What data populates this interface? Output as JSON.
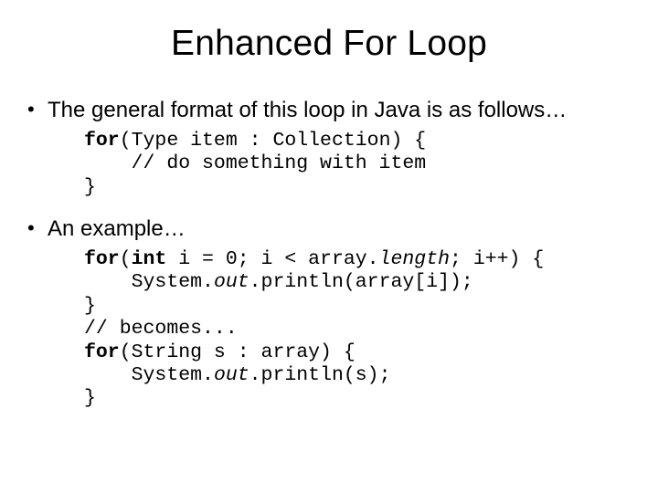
{
  "title": "Enhanced For Loop",
  "bullets": {
    "b1": "The general format of this loop in Java is as follows…",
    "b2": "An example…"
  },
  "code1": {
    "l1a": "for",
    "l1b": "(Type item : Collection) {",
    "l2": "    // do something with item",
    "l3": "}"
  },
  "code2": {
    "l1a": "for",
    "l1b": "(",
    "l1c": "int",
    "l1d": " i = 0; i < array.",
    "l1e": "length",
    "l1f": "; i++) {",
    "l2a": "    System.",
    "l2b": "out",
    "l2c": ".println(array[i]);",
    "l3": "}",
    "l4": "// becomes...",
    "l5a": "for",
    "l5b": "(String s : array) {",
    "l6a": "    System.",
    "l6b": "out",
    "l6c": ".println(s);",
    "l7": "}"
  }
}
